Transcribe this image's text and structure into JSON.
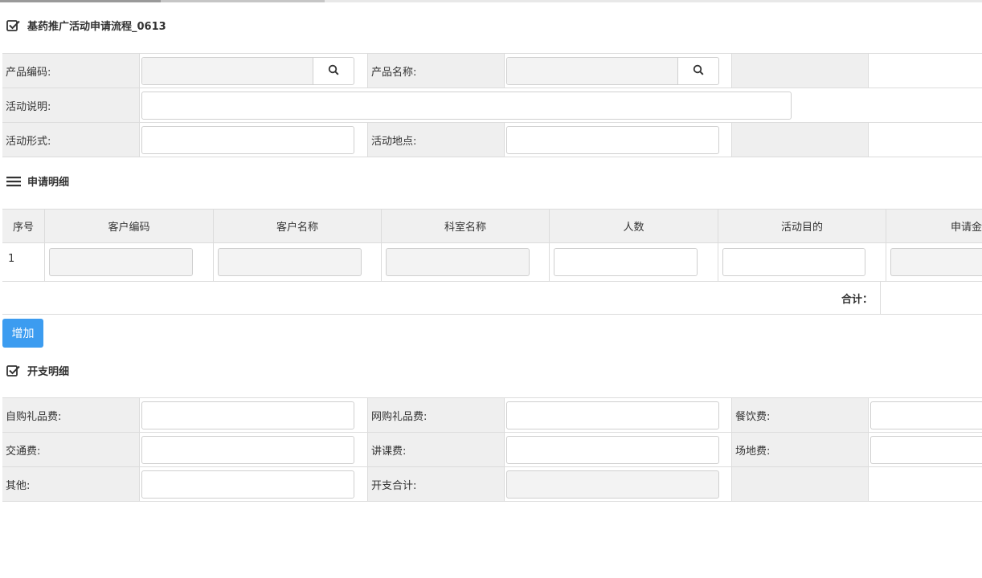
{
  "form_title": "基药推广活动申请流程_0613",
  "product": {
    "code_label": "产品编码:",
    "name_label": "产品名称:",
    "code_value": "",
    "name_value": ""
  },
  "activity": {
    "desc_label": "活动说明:",
    "form_label": "活动形式:",
    "place_label": "活动地点:",
    "desc_value": "",
    "form_value": "",
    "place_value": ""
  },
  "detail": {
    "title": "申请明细",
    "columns": [
      "序号",
      "客户编码",
      "客户名称",
      "科室名称",
      "人数",
      "活动目的",
      "申请金"
    ],
    "rows": [
      {
        "seq": "1",
        "customer_code": "",
        "customer_name": "",
        "dept_name": "",
        "people": "",
        "purpose": "",
        "amount": ""
      }
    ],
    "total_label": "合计：",
    "add_label": "增加"
  },
  "expense": {
    "title": "开支明细",
    "self_gift_label": "自购礼品费:",
    "online_gift_label": "网购礼品费:",
    "meal_label": "餐饮费:",
    "traffic_label": "交通费:",
    "lecture_label": "讲课费:",
    "venue_label": "场地费:",
    "other_label": "其他:",
    "total_label": "开支合计:"
  },
  "icons": {
    "search": "search-icon",
    "checked": "checkbox-checked-icon",
    "list": "list-icon"
  },
  "colors": {
    "primary_button": "#3c9cf0",
    "label_bg": "#efefef"
  }
}
